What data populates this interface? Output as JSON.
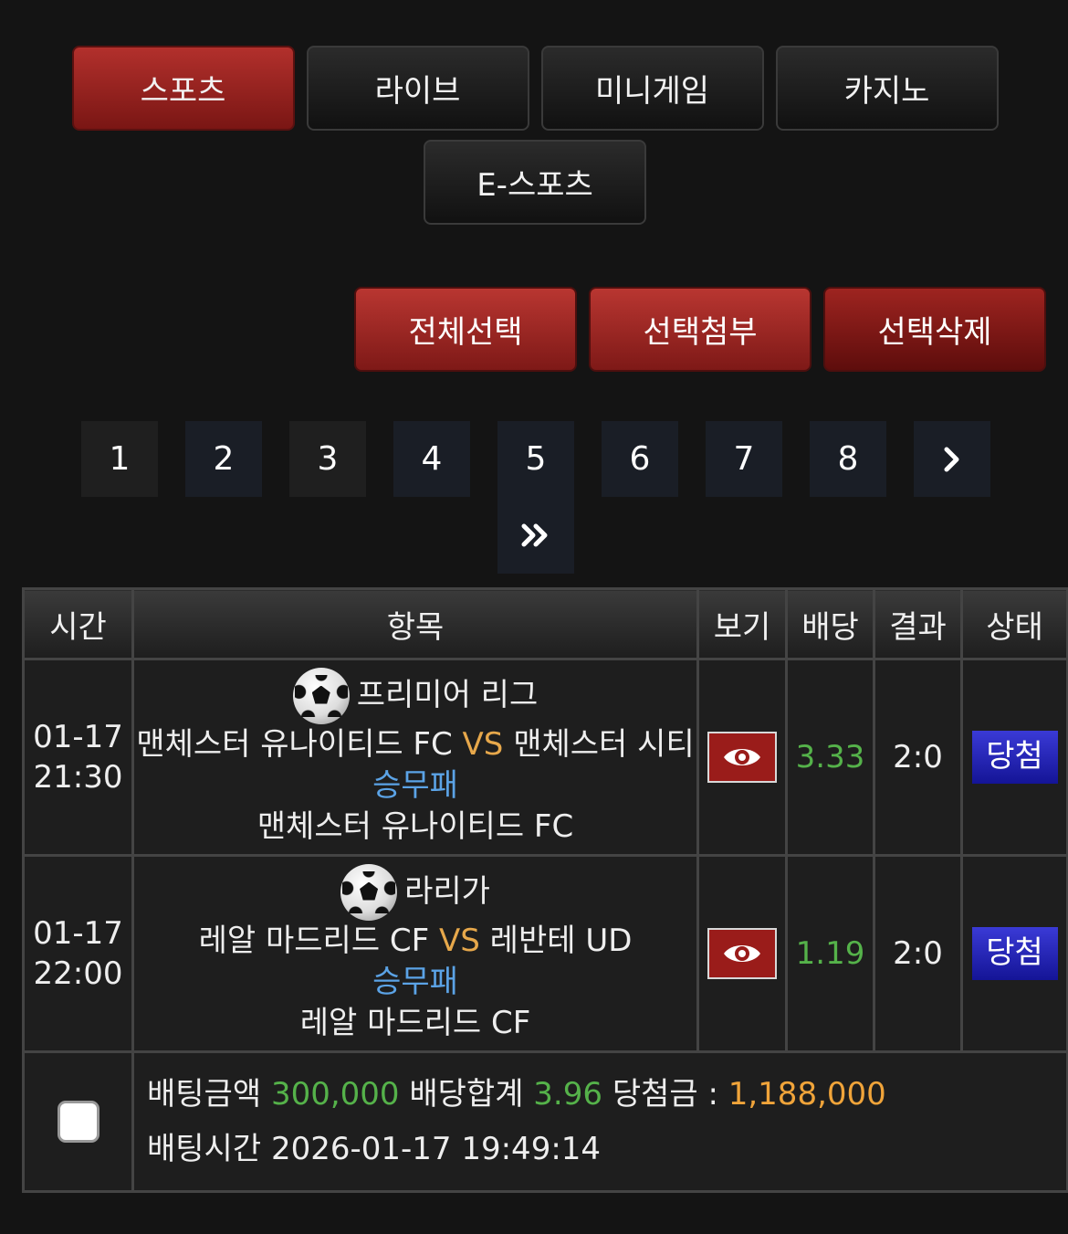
{
  "tabs": [
    {
      "label": "스포츠",
      "active": true
    },
    {
      "label": "라이브",
      "active": false
    },
    {
      "label": "미니게임",
      "active": false
    },
    {
      "label": "카지노",
      "active": false
    },
    {
      "label": "E-스포츠",
      "active": false
    }
  ],
  "actions": {
    "select_all": "전체선택",
    "attach_selected": "선택첨부",
    "delete_selected": "선택삭제"
  },
  "pagination": {
    "pages": [
      "1",
      "2",
      "3",
      "4",
      "5",
      "6",
      "7",
      "8"
    ],
    "next": "›",
    "last": "»"
  },
  "table": {
    "headers": {
      "time": "시간",
      "item": "항목",
      "view": "보기",
      "odds": "배당",
      "result": "결과",
      "status": "상태"
    },
    "bets": [
      {
        "date": "01-17",
        "time": "21:30",
        "league": "프리미어 리그",
        "home": "맨체스터 유나이티드 FC",
        "vs": "VS",
        "away": "맨체스터 시티",
        "market": "승무패",
        "pick": "맨체스터 유나이티드 FC",
        "odds": "3.33",
        "result": "2:0",
        "status": "당첨"
      },
      {
        "date": "01-17",
        "time": "22:00",
        "league": "라리가",
        "home": "레알 마드리드 CF",
        "vs": "VS",
        "away": "레반테 UD",
        "market": "승무패",
        "pick": "레알 마드리드 CF",
        "odds": "1.19",
        "result": "2:0",
        "status": "당첨"
      }
    ],
    "summary": {
      "amount_label": "배팅금액",
      "amount": "300,000",
      "odds_total_label": "배당합계",
      "odds_total": "3.96",
      "win_label": "당첨금 :",
      "win_amount": "1,188,000",
      "bet_time_label": "배팅시간",
      "bet_time": "2026-01-17 19:49:14"
    }
  },
  "colors": {
    "accent_red": "#b2302c",
    "odds_green": "#55b24a",
    "vs_orange": "#e7a84b",
    "market_blue": "#5ba3e6",
    "status_blue": "#2a2ac0"
  }
}
